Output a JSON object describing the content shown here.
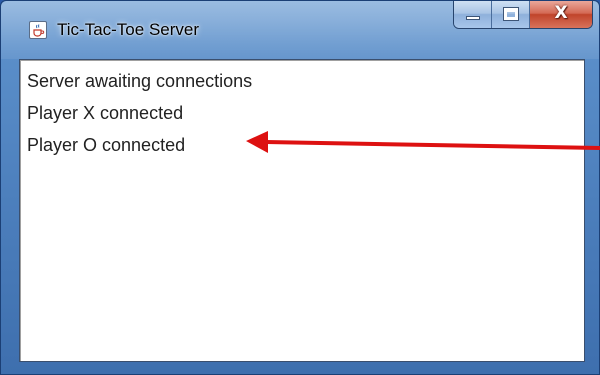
{
  "window": {
    "title": "Tic-Tac-Toe Server",
    "close_glyph": "X"
  },
  "log": {
    "lines": [
      "Server awaiting connections",
      "Player X connected",
      "Player O connected"
    ]
  },
  "icons": {
    "app": "java-cup-icon",
    "minimize": "minimize-icon",
    "maximize": "maximize-icon",
    "close": "close-icon",
    "annotation": "red-arrow-annotation"
  },
  "colors": {
    "arrow": "#dd1111",
    "close_button": "#c0442b",
    "titlebar": "#5b8fca"
  }
}
